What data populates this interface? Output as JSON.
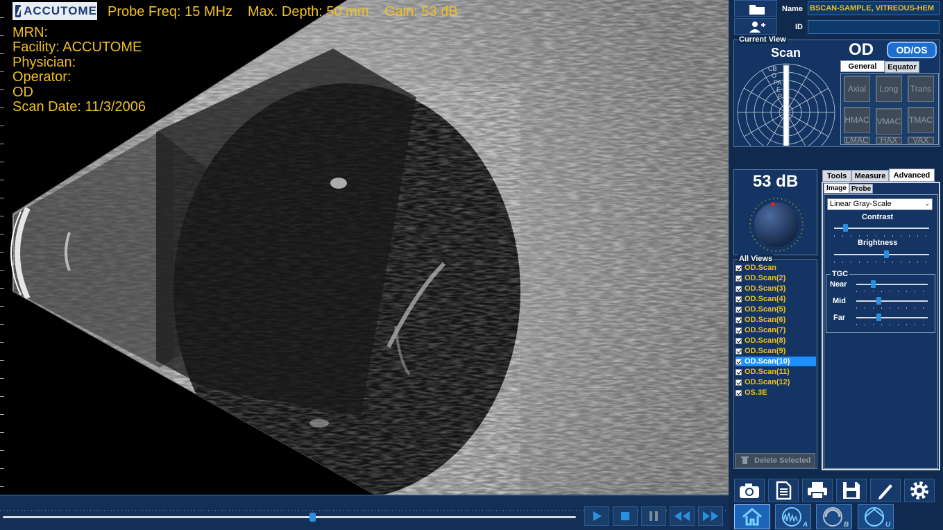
{
  "header": {
    "brand": "ACCUTOME",
    "probe_freq": "Probe Freq: 15 MHz",
    "max_depth": "Max. Depth: 50 mm",
    "gain": "Gain: 53 dB"
  },
  "patient_info": {
    "mrn": "MRN:",
    "facility": "Facility: ACCUTOME",
    "physician": "Physician:",
    "operator": "Operator:",
    "eye": "OD",
    "scan_date": "Scan Date: 11/3/2006"
  },
  "patient_panel": {
    "name_label": "Name",
    "name_value": "BSCAN-SAMPLE, VITREOUS-HEM",
    "id_label": "ID",
    "id_value": ""
  },
  "current_view": {
    "group_label": "Current View",
    "view_name": "Scan",
    "eye": "OD",
    "toggle_label": "OD/OS",
    "clock_labels": [
      "CB",
      "O",
      "PA",
      "E",
      "P"
    ],
    "tabs": [
      "General",
      "Equator"
    ],
    "active_tab": "General",
    "position_buttons": [
      "Axial",
      "Long",
      "Trans",
      "HMAC",
      "VMAC",
      "TMAC",
      "LMAC",
      "HAX",
      "VAX"
    ]
  },
  "gain_knob": {
    "value": "53 dB"
  },
  "all_views": {
    "group_label": "All Views",
    "items": [
      "OD.Scan",
      "OD.Scan(2)",
      "OD.Scan(3)",
      "OD.Scan(4)",
      "OD.Scan(5)",
      "OD.Scan(6)",
      "OD.Scan(7)",
      "OD.Scan(8)",
      "OD.Scan(9)",
      "OD.Scan(10)",
      "OD.Scan(11)",
      "OD.Scan(12)",
      "OS.3E"
    ],
    "selected": "OD.Scan(10)",
    "delete_label": "Delete Selected"
  },
  "settings": {
    "tabs": [
      "Tools",
      "Measure",
      "Advanced"
    ],
    "active_tab": "Advanced",
    "subtabs": [
      "Image",
      "Probe"
    ],
    "active_subtab": "Image",
    "colormap": "Linear Gray-Scale",
    "contrast_label": "Contrast",
    "contrast_value": 0.1,
    "brightness_label": "Brightness",
    "brightness_value": 0.55,
    "tgc_label": "TGC",
    "tgc": [
      {
        "label": "Near",
        "value": 0.22
      },
      {
        "label": "Mid",
        "value": 0.3
      },
      {
        "label": "Far",
        "value": 0.3
      }
    ]
  },
  "timeline": {
    "progress": 0.54
  },
  "toolbar": {
    "icons": [
      "camera-icon",
      "report-icon",
      "print-icon",
      "save-icon",
      "edit-icon",
      "gear-icon"
    ],
    "modes": [
      "home-icon",
      "a-scan-icon",
      "b-scan-icon",
      "u-scan-icon"
    ],
    "mode_letters": [
      "A",
      "B",
      "U"
    ]
  },
  "colors": {
    "accent_text": "#f0c020",
    "panel_bg": "#0f2a4c",
    "selection": "#1e90ff"
  }
}
